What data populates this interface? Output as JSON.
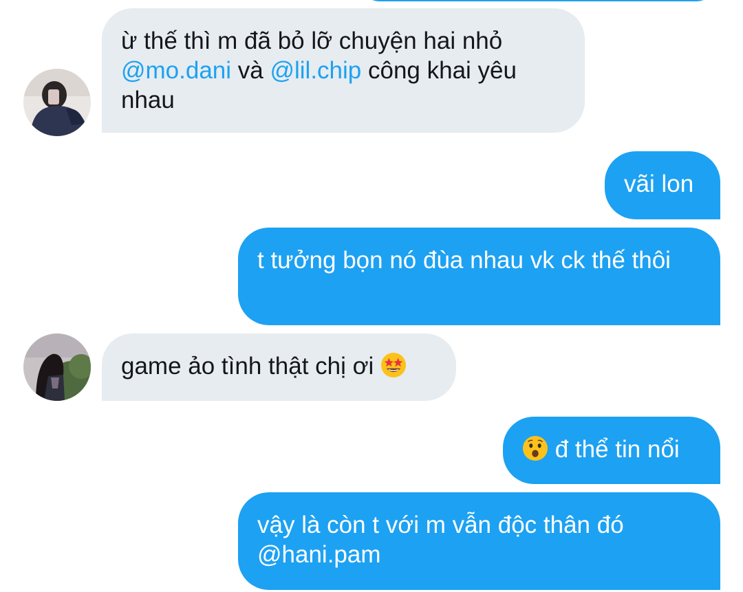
{
  "conversation": {
    "messages": [
      {
        "direction": "incoming",
        "segments": [
          {
            "text": "ừ thế thì m đã bỏ lỡ chuyện hai nhỏ ",
            "type": "text"
          },
          {
            "text": "@mo.dani",
            "type": "mention"
          },
          {
            "text": " và ",
            "type": "text"
          },
          {
            "text": "@lil.chip",
            "type": "mention"
          },
          {
            "text": " công khai yêu nhau",
            "type": "text"
          }
        ]
      },
      {
        "direction": "outgoing",
        "text": "vãi lon"
      },
      {
        "direction": "outgoing",
        "text": "t tưởng bọn nó đùa nhau vk ck thế thôi"
      },
      {
        "direction": "incoming",
        "text": "game ảo tình thật chị ơi ",
        "emoji": "star-struck-emoji"
      },
      {
        "direction": "outgoing",
        "emoji": "astonished-face-emoji",
        "text": " đ thể tin nổi"
      },
      {
        "direction": "outgoing",
        "text": "vậy là còn t với m vẫn độc thân đó @hani.pam"
      }
    ]
  },
  "colors": {
    "outgoing_bubble": "#1da1f2",
    "incoming_bubble": "#e6ecf0",
    "incoming_text": "#14171a",
    "mention": "#1da1f2"
  }
}
